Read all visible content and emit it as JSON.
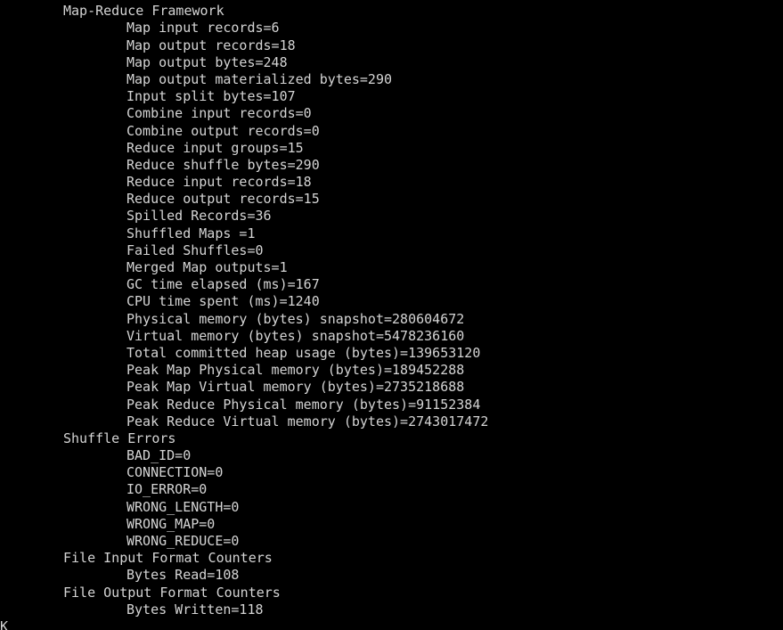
{
  "terminal": {
    "background_color": "#000000",
    "text_color": "#d4d4d4",
    "clipped_top_line": "",
    "sections": [
      {
        "header": "Map-Reduce Framework",
        "counters": [
          "Map input records=6",
          "Map output records=18",
          "Map output bytes=248",
          "Map output materialized bytes=290",
          "Input split bytes=107",
          "Combine input records=0",
          "Combine output records=0",
          "Reduce input groups=15",
          "Reduce shuffle bytes=290",
          "Reduce input records=18",
          "Reduce output records=15",
          "Spilled Records=36",
          "Shuffled Maps =1",
          "Failed Shuffles=0",
          "Merged Map outputs=1",
          "GC time elapsed (ms)=167",
          "CPU time spent (ms)=1240",
          "Physical memory (bytes) snapshot=280604672",
          "Virtual memory (bytes) snapshot=5478236160",
          "Total committed heap usage (bytes)=139653120",
          "Peak Map Physical memory (bytes)=189452288",
          "Peak Map Virtual memory (bytes)=2735218688",
          "Peak Reduce Physical memory (bytes)=91152384",
          "Peak Reduce Virtual memory (bytes)=2743017472"
        ]
      },
      {
        "header": "Shuffle Errors",
        "counters": [
          "BAD_ID=0",
          "CONNECTION=0",
          "IO_ERROR=0",
          "WRONG_LENGTH=0",
          "WRONG_MAP=0",
          "WRONG_REDUCE=0"
        ]
      },
      {
        "header": "File Input Format Counters",
        "counters": [
          "Bytes Read=108"
        ]
      },
      {
        "header": "File Output Format Counters",
        "counters": [
          "Bytes Written=118"
        ]
      }
    ],
    "status_line": "OK"
  }
}
